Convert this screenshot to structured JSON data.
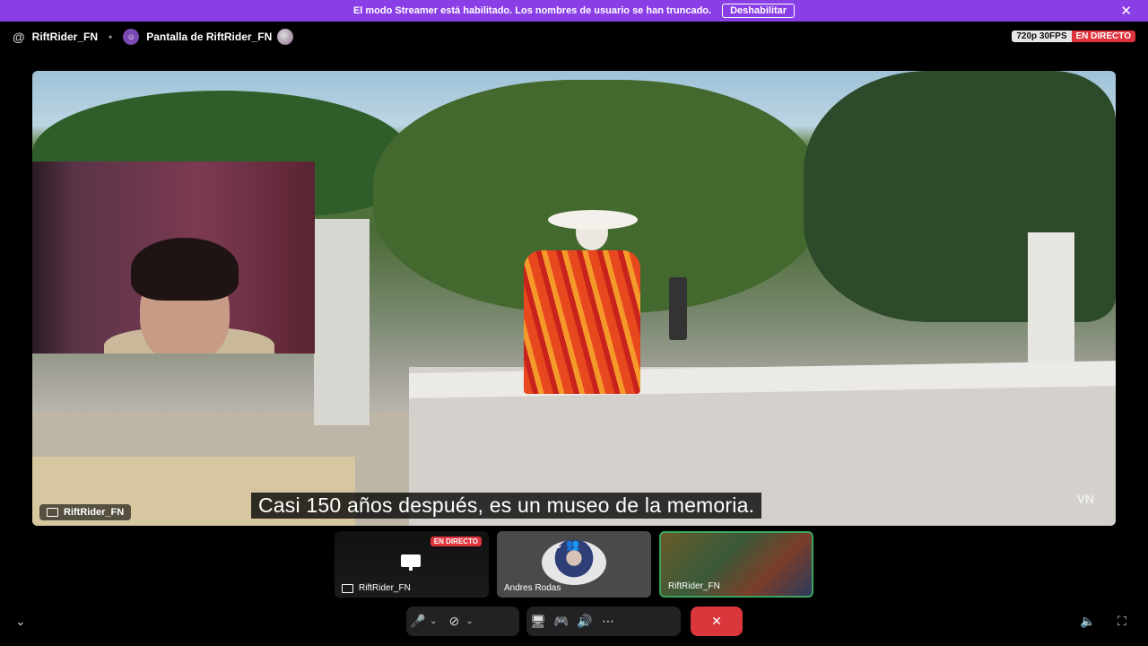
{
  "banner": {
    "message": "El modo Streamer está habilitado. Los nombres de usuario se han truncado.",
    "disable_label": "Deshabilitar",
    "close_icon": "close-icon"
  },
  "header": {
    "at_symbol": "@",
    "username": "RiftRider_FN",
    "separator": "•",
    "screen_title": "Pantalla de RiftRider_FN",
    "quality": "720p 30FPS",
    "live": "EN DIRECTO"
  },
  "stage": {
    "subtitle": "Casi 150 años después, es un museo de la memoria.",
    "label": "RiftRider_FN",
    "watermark": "VN"
  },
  "tiles": [
    {
      "label": "RiftRider_FN",
      "live": "EN DIRECTO"
    },
    {
      "label": "Andres Rodas"
    },
    {
      "label": "RiftRider_FN"
    }
  ],
  "colors": {
    "banner_bg": "#8a3fe6",
    "live_red": "#e0343d",
    "end_call_red": "#da373c",
    "speaking_green": "#3ba55d"
  }
}
